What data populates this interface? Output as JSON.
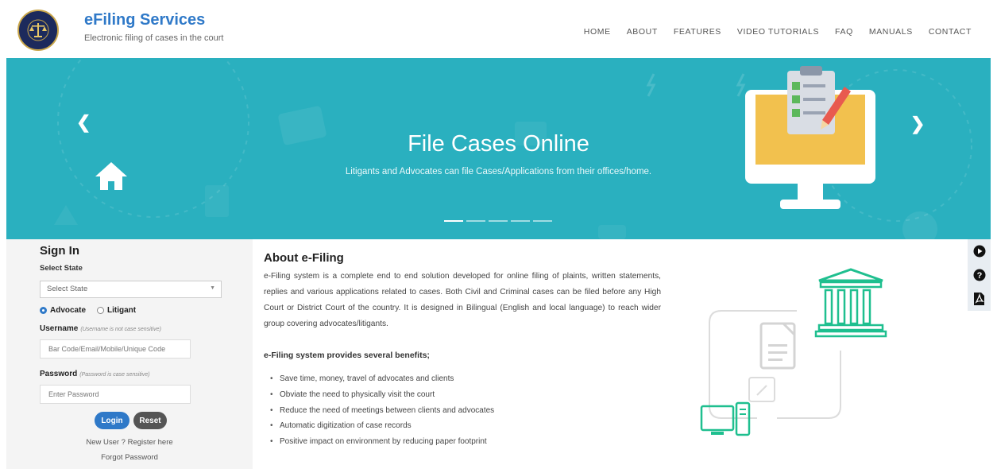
{
  "header": {
    "title": "eFiling Services",
    "subtitle": "Electronic filing of cases in the court",
    "nav": [
      "HOME",
      "ABOUT",
      "FEATURES",
      "VIDEO TUTORIALS",
      "FAQ",
      "MANUALS",
      "CONTACT"
    ]
  },
  "hero": {
    "title": "File Cases Online",
    "subtitle": "Litigants and Advocates can file Cases/Applications from their offices/home.",
    "prev_icon": "chevron-left-icon",
    "next_icon": "chevron-right-icon",
    "slides_count": 5,
    "active_slide": 1,
    "background_color": "#2ab0bf"
  },
  "signin": {
    "title": "Sign In",
    "state_label": "Select State",
    "state_value": "Select State",
    "radio_advocate": "Advocate",
    "radio_litigant": "Litigant",
    "selected_role": "Advocate",
    "username_label": "Username",
    "username_hint": "(Username is not case sensitive)",
    "username_placeholder": "Bar Code/Email/Mobile/Unique Code",
    "password_label": "Password",
    "password_hint": "(Password is case sensitive)",
    "password_placeholder": "Enter Password",
    "login_label": "Login",
    "reset_label": "Reset",
    "register_link": "New User ? Register here",
    "forgot_link": "Forgot Password"
  },
  "about": {
    "title": "About e-Filing",
    "description": "e-Filing system is a complete end to end solution developed for online filing of plaints, written statements, replies and various applications related to cases. Both Civil and Criminal cases can be filed before any High Court or District Court of the country. It is designed in Bilingual (English and local language) to reach wider group covering advocates/litigants.",
    "benefits_heading": "e-Filing system provides several benefits;",
    "benefits": [
      "Save time, money, travel of advocates and clients",
      "Obviate the need to physically visit the court",
      "Reduce the need of meetings between clients and advocates",
      "Automatic digitization of case records",
      "Positive impact on environment by reducing paper footprint"
    ]
  },
  "side_icons": [
    "play-circle-icon",
    "question-circle-icon",
    "pdf-file-icon"
  ],
  "colors": {
    "brand_blue": "#2f79c8",
    "teal": "#2ab0bf",
    "green_accent": "#1fbf8f"
  }
}
